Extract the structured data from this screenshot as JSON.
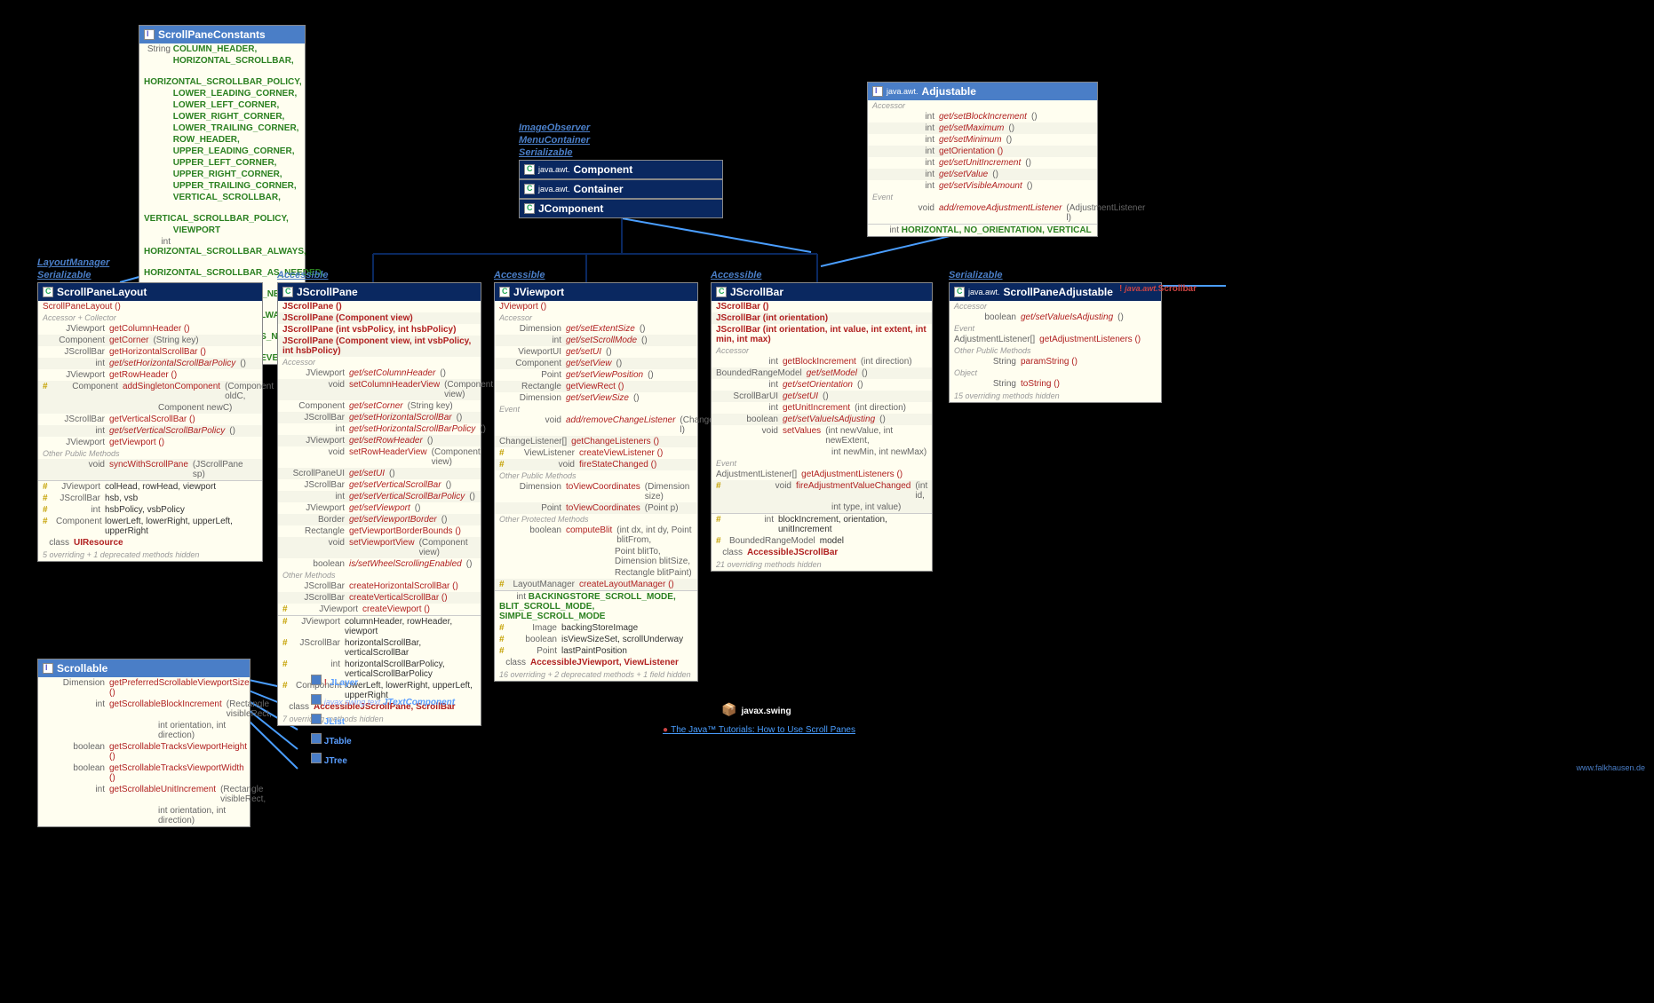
{
  "pkg_title": "javax.swing",
  "tutorial_link": "The Java™ Tutorials: How to Use Scroll Panes",
  "credit": "www.falkhausen.de",
  "interfaces": {
    "layoutmgr": "LayoutManager",
    "serializable": "Serializable",
    "accessible": "Accessible",
    "imageobserver": "ImageObserver",
    "menucontainer": "MenuContainer"
  },
  "hierarchy": {
    "component": {
      "pkg": "java.awt.",
      "name": "Component"
    },
    "container": {
      "pkg": "java.awt.",
      "name": "Container"
    },
    "jcomponent": {
      "name": "JComponent"
    }
  },
  "scrollpaneconstants": {
    "name": "ScrollPaneConstants",
    "string_consts": [
      "COLUMN_HEADER,",
      "HORIZONTAL_SCROLLBAR,",
      "HORIZONTAL_SCROLLBAR_POLICY,",
      "LOWER_LEADING_CORNER,",
      "LOWER_LEFT_CORNER,",
      "LOWER_RIGHT_CORNER,",
      "LOWER_TRAILING_CORNER,",
      "ROW_HEADER,",
      "UPPER_LEADING_CORNER,",
      "UPPER_LEFT_CORNER,",
      "UPPER_RIGHT_CORNER,",
      "UPPER_TRAILING_CORNER,",
      "VERTICAL_SCROLLBAR,",
      "VERTICAL_SCROLLBAR_POLICY,",
      "VIEWPORT"
    ],
    "int_consts": [
      "HORIZONTAL_SCROLLBAR_ALWAYS,",
      "HORIZONTAL_SCROLLBAR_AS_NEEDED,",
      "HORIZONTAL_SCROLLBAR_NEVER,",
      "VERTICAL_SCROLLBAR_ALWAYS,",
      "VERTICAL_SCROLLBAR_AS_NEEDED,",
      "VERTICAL_SCROLLBAR_NEVER"
    ]
  },
  "scrollpanelayout": {
    "name": "ScrollPaneLayout",
    "ctor": "ScrollPaneLayout ()",
    "section1": "Accessor + Collector",
    "rows": [
      {
        "type": "JViewport",
        "m": "getColumnHeader ()",
        "alt": false
      },
      {
        "type": "Component",
        "m": "getCorner",
        "p": " (String key)",
        "alt": true
      },
      {
        "type": "JScrollBar",
        "m": "getHorizontalScrollBar ()",
        "alt": false
      },
      {
        "type": "int",
        "m": "get/setHorizontalScrollBarPolicy",
        "p": " ()",
        "alt": true,
        "it": true
      },
      {
        "type": "JViewport",
        "m": "getRowHeader ()",
        "alt": false
      },
      {
        "hash": "#",
        "type": "Component",
        "m": "addSingletonComponent",
        "p": " (Component oldC,",
        "alt": true
      },
      {
        "type": "",
        "m": "",
        "p": "Component newC)",
        "alt": true,
        "indent": true
      },
      {
        "type": "JScrollBar",
        "m": "getVerticalScrollBar ()",
        "alt": false
      },
      {
        "type": "int",
        "m": "get/setVerticalScrollBarPolicy",
        "p": " ()",
        "alt": true,
        "it": true
      },
      {
        "type": "JViewport",
        "m": "getViewport ()",
        "alt": false
      }
    ],
    "section2": "Other Public Methods",
    "rows2": [
      {
        "type": "void",
        "m": "syncWithScrollPane",
        "p": " (JScrollPane sp)",
        "alt": true
      }
    ],
    "fields": [
      {
        "hash": "#",
        "type": "JViewport",
        "m": "colHead, rowHead, viewport"
      },
      {
        "hash": "#",
        "type": "JScrollBar",
        "m": "hsb, vsb"
      },
      {
        "hash": "#",
        "type": "int",
        "m": "hsbPolicy, vsbPolicy"
      },
      {
        "hash": "#",
        "type": "Component",
        "m": "lowerLeft, lowerRight, upperLeft, upperRight"
      }
    ],
    "inner": "UIResource",
    "footer": "5 overriding + 1 deprecated methods hidden"
  },
  "jscrollpane": {
    "name": "JScrollPane",
    "ctors": [
      "JScrollPane ()",
      "JScrollPane (Component view)",
      "JScrollPane (int vsbPolicy, int hsbPolicy)",
      "JScrollPane (Component view, int vsbPolicy, int hsbPolicy)"
    ],
    "section1": "Accessor",
    "rows": [
      {
        "type": "JViewport",
        "m": "get/setColumnHeader",
        "p": " ()",
        "it": true
      },
      {
        "type": "void",
        "m": "setColumnHeaderView",
        "p": " (Component view)",
        "alt": true
      },
      {
        "type": "Component",
        "m": "get/setCorner",
        "p": " (String key)",
        "it": true
      },
      {
        "type": "JScrollBar",
        "m": "get/setHorizontalScrollBar",
        "p": " ()",
        "alt": true,
        "it": true
      },
      {
        "type": "int",
        "m": "get/setHorizontalScrollBarPolicy",
        "p": " ()",
        "it": true
      },
      {
        "type": "JViewport",
        "m": "get/setRowHeader",
        "p": " ()",
        "alt": true,
        "it": true
      },
      {
        "type": "void",
        "m": "setRowHeaderView",
        "p": " (Component view)"
      },
      {
        "type": "ScrollPaneUI",
        "m": "get/setUI",
        "p": " ()",
        "alt": true,
        "it": true
      },
      {
        "type": "JScrollBar",
        "m": "get/setVerticalScrollBar",
        "p": " ()",
        "it": true
      },
      {
        "type": "int",
        "m": "get/setVerticalScrollBarPolicy",
        "p": " ()",
        "alt": true,
        "it": true
      },
      {
        "type": "JViewport",
        "m": "get/setViewport",
        "p": " ()",
        "it": true
      },
      {
        "type": "Border",
        "m": "get/setViewportBorder",
        "p": " ()",
        "alt": true,
        "it": true
      },
      {
        "type": "Rectangle",
        "m": "getViewportBorderBounds ()",
        "p": ""
      },
      {
        "type": "void",
        "m": "setViewportView",
        "p": " (Component view)",
        "alt": true
      },
      {
        "type": "boolean",
        "m": "is/setWheelScrollingEnabled",
        "p": " ()",
        "it": true
      }
    ],
    "section2": "Other Methods",
    "rows2": [
      {
        "type": "JScrollBar",
        "m": "createHorizontalScrollBar ()"
      },
      {
        "type": "JScrollBar",
        "m": "createVerticalScrollBar ()",
        "alt": true
      },
      {
        "hash": "#",
        "type": "JViewport",
        "m": "createViewport ()"
      }
    ],
    "fields": [
      {
        "hash": "#",
        "type": "JViewport",
        "m": "columnHeader, rowHeader, viewport"
      },
      {
        "hash": "#",
        "type": "JScrollBar",
        "m": "horizontalScrollBar, verticalScrollBar"
      },
      {
        "hash": "#",
        "type": "int",
        "m": "horizontalScrollBarPolicy, verticalScrollBarPolicy"
      },
      {
        "hash": "#",
        "type": "Component",
        "m": "lowerLeft, lowerRight, upperLeft, upperRight"
      }
    ],
    "inner": "AccessibleJScrollPane, ScrollBar",
    "footer": "7 overriding methods hidden"
  },
  "jviewport": {
    "name": "JViewport",
    "ctor": "JViewport ()",
    "section1": "Accessor",
    "rows": [
      {
        "type": "Dimension",
        "m": "get/setExtentSize",
        "p": " ()",
        "it": true
      },
      {
        "type": "int",
        "m": "get/setScrollMode",
        "p": " ()",
        "alt": true,
        "it": true
      },
      {
        "type": "ViewportUI",
        "m": "get/setUI",
        "p": " ()",
        "it": true
      },
      {
        "type": "Component",
        "m": "get/setView",
        "p": " ()",
        "alt": true,
        "it": true
      },
      {
        "type": "Point",
        "m": "get/setViewPosition",
        "p": " ()",
        "it": true
      },
      {
        "type": "Rectangle",
        "m": "getViewRect ()",
        "p": "",
        "alt": true
      },
      {
        "type": "Dimension",
        "m": "get/setViewSize",
        "p": " ()",
        "it": true
      }
    ],
    "section2": "Event",
    "rows2": [
      {
        "type": "void",
        "m": "add/removeChangeListener",
        "p": " (ChangeListener l)",
        "it": true
      },
      {
        "type": "ChangeListener[]",
        "m": "getChangeListeners ()",
        "alt": true
      },
      {
        "hash": "#",
        "type": "ViewListener",
        "m": "createViewListener ()"
      },
      {
        "hash": "#",
        "type": "void",
        "m": "fireStateChanged ()",
        "alt": true
      }
    ],
    "section3": "Other Public Methods",
    "rows3": [
      {
        "type": "Dimension",
        "m": "toViewCoordinates",
        "p": " (Dimension size)"
      },
      {
        "type": "Point",
        "m": "toViewCoordinates",
        "p": " (Point p)",
        "alt": true
      }
    ],
    "section4": "Other Protected Methods",
    "rows4": [
      {
        "type": "boolean",
        "m": "computeBlit",
        "p": " (int dx, int dy, Point blitFrom,"
      },
      {
        "type": "",
        "m": "",
        "p": "Point blitTo, Dimension blitSize,",
        "indent": true
      },
      {
        "type": "",
        "m": "",
        "p": "Rectangle blitPaint)",
        "indent": true
      },
      {
        "hash": "#",
        "type": "LayoutManager",
        "m": "createLayoutManager ()",
        "alt": true
      }
    ],
    "consts": "BACKINGSTORE_SCROLL_MODE, BLIT_SCROLL_MODE, SIMPLE_SCROLL_MODE",
    "fields": [
      {
        "hash": "#",
        "type": "Image",
        "m": "backingStoreImage"
      },
      {
        "hash": "#",
        "type": "boolean",
        "m": "isViewSizeSet, scrollUnderway"
      },
      {
        "hash": "#",
        "type": "Point",
        "m": "lastPaintPosition"
      }
    ],
    "inner": "AccessibleJViewport, ViewListener",
    "footer": "16 overriding + 2 deprecated methods + 1 field hidden"
  },
  "jscrollbar": {
    "name": "JScrollBar",
    "ctors": [
      "JScrollBar ()",
      "JScrollBar (int orientation)",
      "JScrollBar (int orientation, int value, int extent, int min, int max)"
    ],
    "section1": "Accessor",
    "rows": [
      {
        "type": "int",
        "m": "getBlockIncrement",
        "p": " (int direction)"
      },
      {
        "type": "BoundedRangeModel",
        "m": "get/setModel",
        "p": " ()",
        "alt": true,
        "it": true
      },
      {
        "type": "int",
        "m": "get/setOrientation",
        "p": " ()",
        "it": true
      },
      {
        "type": "ScrollBarUI",
        "m": "get/setUI",
        "p": " ()",
        "alt": true,
        "it": true
      },
      {
        "type": "int",
        "m": "getUnitIncrement",
        "p": " (int direction)"
      },
      {
        "type": "boolean",
        "m": "get/setValueIsAdjusting",
        "p": " ()",
        "alt": true,
        "it": true
      },
      {
        "type": "void",
        "m": "setValues",
        "p": " (int newValue, int newExtent,"
      },
      {
        "type": "",
        "m": "",
        "p": "int newMin, int newMax)",
        "indent": true
      }
    ],
    "section2": "Event",
    "rows2": [
      {
        "type": "AdjustmentListener[]",
        "m": "getAdjustmentListeners ()"
      },
      {
        "hash": "#",
        "type": "void",
        "m": "fireAdjustmentValueChanged",
        "p": " (int id,",
        "alt": true
      },
      {
        "type": "",
        "m": "",
        "p": "int type, int value)",
        "indent": true,
        "alt": true
      }
    ],
    "fields": [
      {
        "hash": "#",
        "type": "int",
        "m": "blockIncrement, orientation, unitIncrement"
      },
      {
        "hash": "#",
        "type": "BoundedRangeModel",
        "m": "model"
      }
    ],
    "inner": "AccessibleJScrollBar",
    "footer": "21 overriding methods hidden"
  },
  "adjustable": {
    "pkg": "java.awt.",
    "name": "Adjustable",
    "section1": "Accessor",
    "rows": [
      {
        "type": "int",
        "m": "get/setBlockIncrement",
        "p": " ()",
        "it": true
      },
      {
        "type": "int",
        "m": "get/setMaximum",
        "p": " ()",
        "alt": true,
        "it": true
      },
      {
        "type": "int",
        "m": "get/setMinimum",
        "p": " ()",
        "it": true
      },
      {
        "type": "int",
        "m": "getOrientation ()",
        "alt": true
      },
      {
        "type": "int",
        "m": "get/setUnitIncrement",
        "p": " ()",
        "it": true
      },
      {
        "type": "int",
        "m": "get/setValue",
        "p": " ()",
        "alt": true,
        "it": true
      },
      {
        "type": "int",
        "m": "get/setVisibleAmount",
        "p": " ()",
        "it": true
      }
    ],
    "section2": "Event",
    "rows2": [
      {
        "type": "void",
        "m": "add/removeAdjustmentListener",
        "p": " (AdjustmentListener l)",
        "it": true
      }
    ],
    "consts": "HORIZONTAL, NO_ORIENTATION, VERTICAL"
  },
  "scrollpaneadjustable": {
    "pkg": "java.awt.",
    "name": "ScrollPaneAdjustable",
    "section1": "Accessor",
    "rows": [
      {
        "type": "boolean",
        "m": "get/setValueIsAdjusting",
        "p": " ()",
        "it": true
      }
    ],
    "section2": "Event",
    "rows2": [
      {
        "type": "AdjustmentListener[]",
        "m": "getAdjustmentListeners ()"
      }
    ],
    "section3": "Other Public Methods",
    "rows3": [
      {
        "type": "String",
        "m": "paramString ()"
      }
    ],
    "section4": "Object",
    "rows4": [
      {
        "type": "String",
        "m": "toString ()"
      }
    ],
    "footer": "15 overriding methods hidden"
  },
  "scrollbar_deprecated": {
    "pkg": "java.awt.",
    "name": "Scrollbar"
  },
  "scrollable": {
    "name": "Scrollable",
    "rows": [
      {
        "type": "Dimension",
        "m": "getPreferredScrollableViewportSize ()"
      },
      {
        "type": "int",
        "m": "getScrollableBlockIncrement",
        "p": " (Rectangle visibleRect,"
      },
      {
        "type": "",
        "m": "",
        "p": "int orientation, int direction)",
        "indent": true
      },
      {
        "type": "boolean",
        "m": "getScrollableTracksViewportHeight ()"
      },
      {
        "type": "boolean",
        "m": "getScrollableTracksViewportWidth ()"
      },
      {
        "type": "int",
        "m": "getScrollableUnitIncrement",
        "p": " (Rectangle visibleRect,"
      },
      {
        "type": "",
        "m": "",
        "p": "int orientation, int direction)",
        "indent": true
      }
    ]
  },
  "scrollable_impls": [
    {
      "name": "JLayer<V>",
      "mark": "!"
    },
    {
      "pkg": "javax.swing.text.",
      "name": "JTextComponent",
      "abstract": true
    },
    {
      "name": "JList<E>"
    },
    {
      "name": "JTable"
    },
    {
      "name": "JTree"
    }
  ]
}
